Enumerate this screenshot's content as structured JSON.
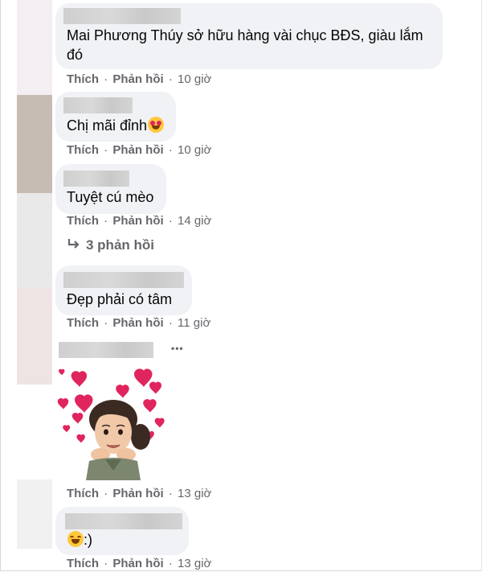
{
  "actions": {
    "like": "Thích",
    "reply": "Phản hồi",
    "separator": "·"
  },
  "comments": [
    {
      "text": "Mai Phương Thúy sở hữu hàng vài chục BĐS, giàu lắm đó",
      "time": "10 giờ"
    },
    {
      "text": "Chị mãi đỉnh",
      "emoji": "heart-eyes-emoji",
      "time": "10 giờ"
    },
    {
      "text": "Tuyệt cú mèo",
      "time": "14 giờ",
      "replies": "3 phản hồi"
    },
    {
      "text": "Đẹp phải có tâm",
      "time": "11 giờ"
    },
    {
      "sticker": "hearts-avatar-sticker",
      "more": "•••",
      "time": "13 giờ"
    },
    {
      "text": ":)",
      "emoji": "laughing-emoji",
      "time": "13 giờ"
    }
  ],
  "colors": {
    "bubble": "#f0f2f5",
    "meta": "#65676b",
    "heart": "#e0245e"
  }
}
